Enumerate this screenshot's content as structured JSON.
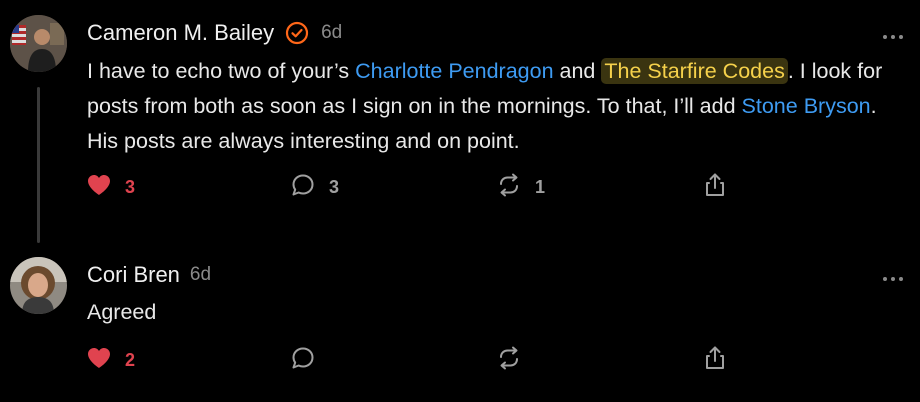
{
  "comments": [
    {
      "author": "Cameron M. Bailey",
      "verified": true,
      "time": "6d",
      "text_parts": {
        "t1": "I have to echo two of your’s ",
        "m1": "Charlotte Pendragon",
        "t2": " and ",
        "m2": "The Starfire Codes",
        "t3": ". I look for posts from both as soon as I sign on in the mornings. To that, I’ll add ",
        "m3": "Stone Bryson",
        "t4": ". His posts are always interesting and on point."
      },
      "likes": "3",
      "replies": "3",
      "restacks": "1"
    },
    {
      "author": "Cori Bren",
      "verified": false,
      "time": "6d",
      "text": "Agreed",
      "likes": "2"
    }
  ],
  "icons": {
    "like": "heart-icon",
    "reply": "comment-bubble-icon",
    "restack": "restack-icon",
    "share": "share-icon",
    "more": "more-options-icon",
    "verified": "verified-check-icon"
  },
  "colors": {
    "background": "#000000",
    "text": "#e8e8e8",
    "muted": "#8a8a8a",
    "mention": "#3e9bf2",
    "highlight_text": "#f5d14b",
    "highlight_bg": "#3a3410",
    "like": "#e0434f",
    "verified": "#ff6719"
  }
}
